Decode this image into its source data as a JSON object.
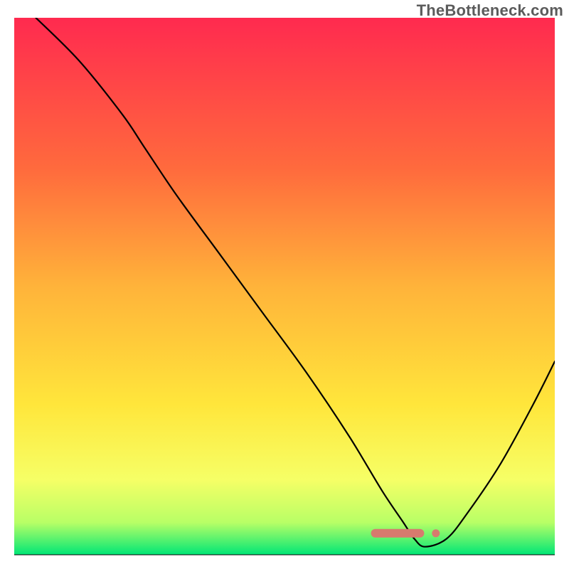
{
  "watermark": "TheBottleneck.com",
  "colors": {
    "curve": "#000000",
    "marker": "#d77a6e",
    "gradient_top": "#ff2a4f",
    "gradient_mid1": "#ff6a3d",
    "gradient_mid2": "#ffb33a",
    "gradient_mid3": "#ffe63b",
    "gradient_low1": "#f6ff66",
    "gradient_low2": "#b8ff66",
    "gradient_bottom": "#00e676"
  },
  "chart_data": {
    "type": "line",
    "title": "",
    "xlabel": "",
    "ylabel": "",
    "xlim": [
      0,
      100
    ],
    "ylim": [
      0,
      100
    ],
    "series": [
      {
        "name": "bottleneck-curve",
        "x": [
          4,
          12,
          20,
          24,
          30,
          38,
          46,
          54,
          62,
          68,
          72,
          74,
          76,
          80,
          84,
          90,
          96,
          100
        ],
        "values": [
          100,
          92,
          82,
          76,
          67,
          56,
          45,
          34,
          22,
          12,
          6,
          3,
          1.5,
          3,
          8,
          17,
          28,
          36
        ]
      }
    ],
    "annotations": [
      {
        "name": "optimal-range-marker",
        "x_start": 66,
        "x_end": 78,
        "y": 4,
        "color": "#d77a6e"
      }
    ]
  }
}
